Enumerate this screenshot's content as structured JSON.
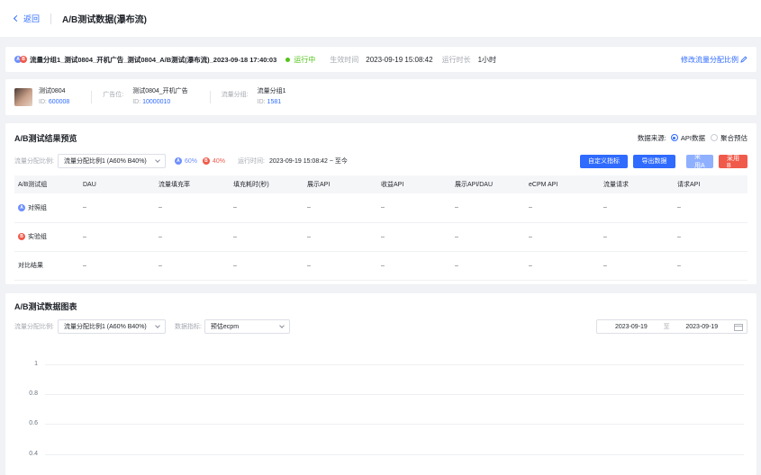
{
  "header": {
    "back_label": "返回",
    "title": "A/B测试数据(瀑布流)"
  },
  "experiment": {
    "name": "流量分组1_测试0804_开机广告_测试0804_A/B测试(瀑布流)_2023-09-18 17:40:03",
    "status": "运行中",
    "effective_time_label": "生效时间",
    "effective_time": "2023-09-19 15:08:42",
    "duration_label": "运行时长",
    "duration": "1小时",
    "modify_link": "修改流量分配比例",
    "status_color": "#52c41a"
  },
  "entities": {
    "app": {
      "name": "测试0804",
      "id_label": "ID:",
      "id": "600008"
    },
    "slot": {
      "label": "广告位:",
      "name": "测试0804_开机广告",
      "id_label": "ID:",
      "id": "10000010"
    },
    "group": {
      "label": "流量分组:",
      "name": "流量分组1",
      "id_label": "ID:",
      "id": "1581"
    }
  },
  "preview": {
    "title": "A/B测试结果预览",
    "source_label": "数据来源:",
    "source_options": [
      "API数据",
      "聚合预估"
    ],
    "ratio_label": "流量分配比例:",
    "ratio_value": "流量分配比例1 (A60% B40%)",
    "a_pct": "60%",
    "b_pct": "40%",
    "time_label": "运行时间:",
    "time_value": "2023-09-19 15:08:42 ~ 至今",
    "buttons": {
      "custom": "自定义指标",
      "export": "导出数据",
      "use_a": "采用A",
      "use_b": "采用B"
    },
    "columns": [
      "A/B测试组",
      "DAU",
      "流量填充率",
      "填充耗时(秒)",
      "展示API",
      "收益API",
      "展示API/DAU",
      "eCPM API",
      "流量请求",
      "请求API"
    ],
    "rows": [
      {
        "group": "对照组",
        "badge": "A",
        "cells": [
          "–",
          "–",
          "–",
          "–",
          "–",
          "–",
          "–",
          "–",
          "–"
        ]
      },
      {
        "group": "实验组",
        "badge": "B",
        "cells": [
          "–",
          "–",
          "–",
          "–",
          "–",
          "–",
          "–",
          "–",
          "–"
        ]
      },
      {
        "group": "对比结果",
        "badge": "",
        "cells": [
          "–",
          "–",
          "–",
          "–",
          "–",
          "–",
          "–",
          "–",
          "–"
        ]
      }
    ]
  },
  "chart_section": {
    "title": "A/B测试数据图表",
    "ratio_label": "流量分配比例:",
    "ratio_value": "流量分配比例1 (A60% B40%)",
    "metric_label": "数据指标:",
    "metric_value": "预估ecpm",
    "date_start": "2023-09-19",
    "date_sep": "至",
    "date_end": "2023-09-19"
  },
  "chart_data": {
    "type": "line",
    "title": "",
    "xlabel": "",
    "ylabel": "",
    "yticks": [
      "1",
      "0.8",
      "0.6",
      "0.4"
    ],
    "series": []
  }
}
